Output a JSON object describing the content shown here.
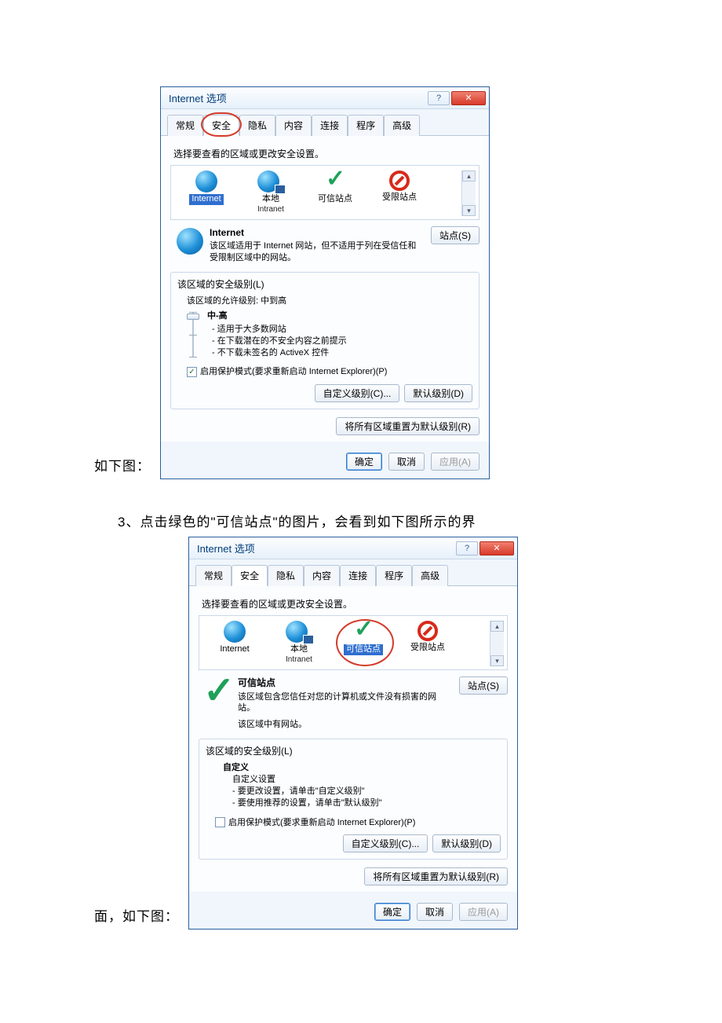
{
  "captions": {
    "before1": "如下图：",
    "step3": "3、点击绿色的\"可信站点\"的图片，会看到如下图所示的界",
    "after2": "面，如下图："
  },
  "dialog": {
    "title": "Internet 选项",
    "tabs": [
      "常规",
      "安全",
      "隐私",
      "内容",
      "连接",
      "程序",
      "高级"
    ],
    "zone_prompt": "选择要查看的区域或更改安全设置。",
    "zones": {
      "internet": "Internet",
      "local": "本地",
      "local_sub": "Intranet",
      "trusted": "可信站点",
      "restricted": "受限站点"
    },
    "sites_btn": "站点(S)",
    "d1": {
      "title": "Internet",
      "desc": "该区域适用于 Internet 网站，但不适用于列在受信任和受限制区域中的网站。"
    },
    "d2": {
      "title": "可信站点",
      "desc1": "该区域包含您信任对您的计算机或文件没有损害的网站。",
      "desc2": "该区域中有网站。"
    },
    "sec_group": "该区域的安全级别(L)",
    "allowed_levels": "该区域的允许级别: 中到高",
    "level_name": "中-高",
    "level_b1": "- 适用于大多数网站",
    "level_b2": "- 在下载潜在的不安全内容之前提示",
    "level_b3": "- 不下载未签名的 ActiveX 控件",
    "custom_title": "自定义",
    "custom_l1": "自定义设置",
    "custom_l2": "- 要更改设置，请单击\"自定义级别\"",
    "custom_l3": "- 要使用推荐的设置，请单击\"默认级别\"",
    "protect": "启用保护模式(要求重新启动 Internet Explorer)(P)",
    "btn_custom": "自定义级别(C)...",
    "btn_default": "默认级别(D)",
    "btn_reset": "将所有区域重置为默认级别(R)",
    "btn_ok": "确定",
    "btn_cancel": "取消",
    "btn_apply": "应用(A)"
  }
}
